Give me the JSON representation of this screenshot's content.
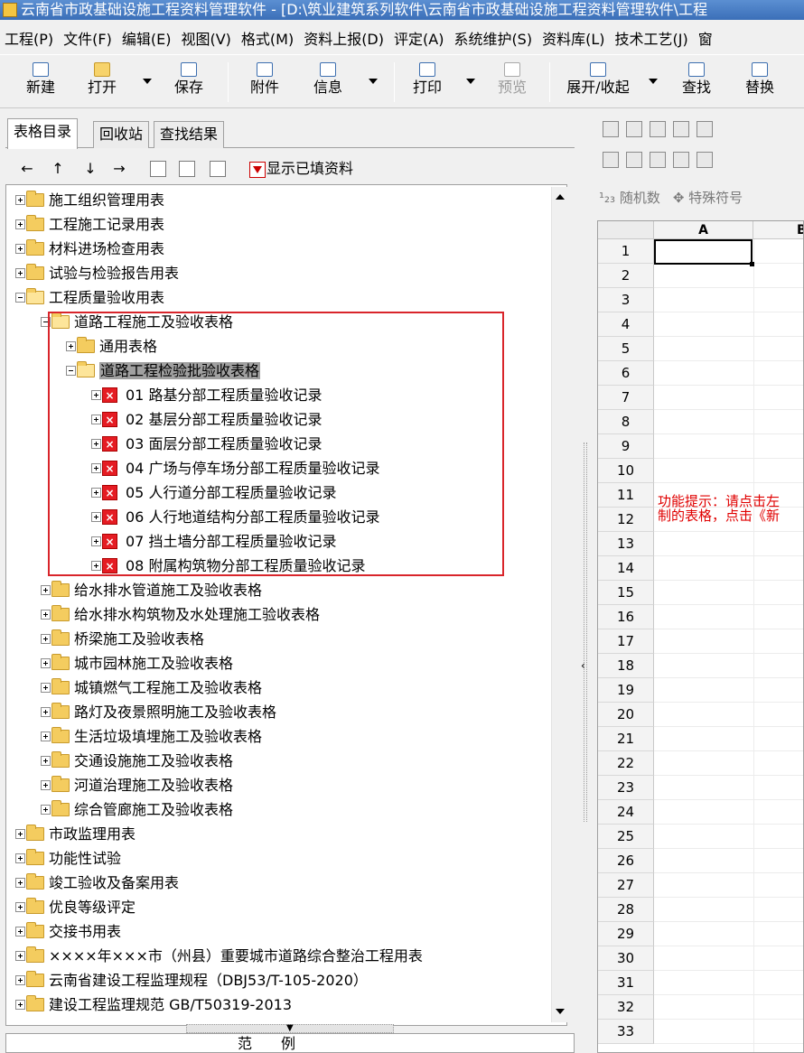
{
  "window": {
    "title": "云南省市政基础设施工程资料管理软件 - [D:\\筑业建筑系列软件\\云南省市政基础设施工程资料管理软件\\工程"
  },
  "menu": [
    "工程(P)",
    "文件(F)",
    "编辑(E)",
    "视图(V)",
    "格式(M)",
    "资料上报(D)",
    "评定(A)",
    "系统维护(S)",
    "资料库(L)",
    "技术工艺(J)",
    "窗"
  ],
  "toolbar": {
    "new": "新建",
    "open": "打开",
    "save": "保存",
    "attach": "附件",
    "info": "信息",
    "print": "打印",
    "preview": "预览",
    "expand": "展开/收起",
    "find": "查找",
    "replace": "替换"
  },
  "tabs": [
    "表格目录",
    "回收站",
    "查找结果"
  ],
  "nav": {
    "filter_label": "显示已填资料"
  },
  "tree": [
    {
      "label": "施工组织管理用表",
      "level": 0,
      "type": "folder"
    },
    {
      "label": "工程施工记录用表",
      "level": 0,
      "type": "folder"
    },
    {
      "label": "材料进场检查用表",
      "level": 0,
      "type": "folder"
    },
    {
      "label": "试验与检验报告用表",
      "level": 0,
      "type": "folder"
    },
    {
      "label": "工程质量验收用表",
      "level": 0,
      "type": "folder-open"
    },
    {
      "label": "道路工程施工及验收表格",
      "level": 1,
      "type": "folder-open"
    },
    {
      "label": "通用表格",
      "level": 2,
      "type": "folder"
    },
    {
      "label": "道路工程检验批验收表格",
      "level": 2,
      "type": "folder-open",
      "selected": true
    },
    {
      "label": "01 路基分部工程质量验收记录",
      "level": 3,
      "type": "file"
    },
    {
      "label": "02 基层分部工程质量验收记录",
      "level": 3,
      "type": "file"
    },
    {
      "label": "03 面层分部工程质量验收记录",
      "level": 3,
      "type": "file"
    },
    {
      "label": "04 广场与停车场分部工程质量验收记录",
      "level": 3,
      "type": "file"
    },
    {
      "label": "05 人行道分部工程质量验收记录",
      "level": 3,
      "type": "file"
    },
    {
      "label": "06 人行地道结构分部工程质量验收记录",
      "level": 3,
      "type": "file"
    },
    {
      "label": "07 挡土墙分部工程质量验收记录",
      "level": 3,
      "type": "file"
    },
    {
      "label": "08 附属构筑物分部工程质量验收记录",
      "level": 3,
      "type": "file"
    },
    {
      "label": "给水排水管道施工及验收表格",
      "level": 1,
      "type": "folder"
    },
    {
      "label": "给水排水构筑物及水处理施工验收表格",
      "level": 1,
      "type": "folder"
    },
    {
      "label": "桥梁施工及验收表格",
      "level": 1,
      "type": "folder"
    },
    {
      "label": "城市园林施工及验收表格",
      "level": 1,
      "type": "folder"
    },
    {
      "label": "城镇燃气工程施工及验收表格",
      "level": 1,
      "type": "folder"
    },
    {
      "label": "路灯及夜景照明施工及验收表格",
      "level": 1,
      "type": "folder"
    },
    {
      "label": "生活垃圾填埋施工及验收表格",
      "level": 1,
      "type": "folder"
    },
    {
      "label": "交通设施施工及验收表格",
      "level": 1,
      "type": "folder"
    },
    {
      "label": "河道治理施工及验收表格",
      "level": 1,
      "type": "folder"
    },
    {
      "label": "综合管廊施工及验收表格",
      "level": 1,
      "type": "folder"
    },
    {
      "label": "市政监理用表",
      "level": 0,
      "type": "folder"
    },
    {
      "label": "功能性试验",
      "level": 0,
      "type": "folder"
    },
    {
      "label": "竣工验收及备案用表",
      "level": 0,
      "type": "folder"
    },
    {
      "label": "优良等级评定",
      "level": 0,
      "type": "folder"
    },
    {
      "label": "交接书用表",
      "level": 0,
      "type": "folder"
    },
    {
      "label": "××××年×××市（州县）重要城市道路综合整治工程用表",
      "level": 0,
      "type": "folder"
    },
    {
      "label": "云南省建设工程监理规程（DBJ53/T-105-2020）",
      "level": 0,
      "type": "folder"
    },
    {
      "label": "建设工程监理规范 GB/T50319-2013",
      "level": 0,
      "type": "folder"
    }
  ],
  "legend": {
    "label": "范　　例"
  },
  "right_toolbar": {
    "random": "随机数",
    "special": "特殊符号"
  },
  "sheet": {
    "columns": [
      "A",
      "B"
    ],
    "rows": [
      "1",
      "2",
      "3",
      "4",
      "5",
      "6",
      "7",
      "8",
      "9",
      "10",
      "11",
      "12",
      "13",
      "14",
      "15",
      "16",
      "17",
      "18",
      "19",
      "20",
      "21",
      "22",
      "23",
      "24",
      "25",
      "26",
      "27",
      "28",
      "29",
      "30",
      "31",
      "32",
      "33"
    ],
    "hint_line1": "功能提示：请点击左",
    "hint_line2": "制的表格，点击《新"
  },
  "colors": {
    "highlight_box": "#d9252b",
    "hint_text": "#e00000",
    "file_icon": "#e51c23"
  }
}
